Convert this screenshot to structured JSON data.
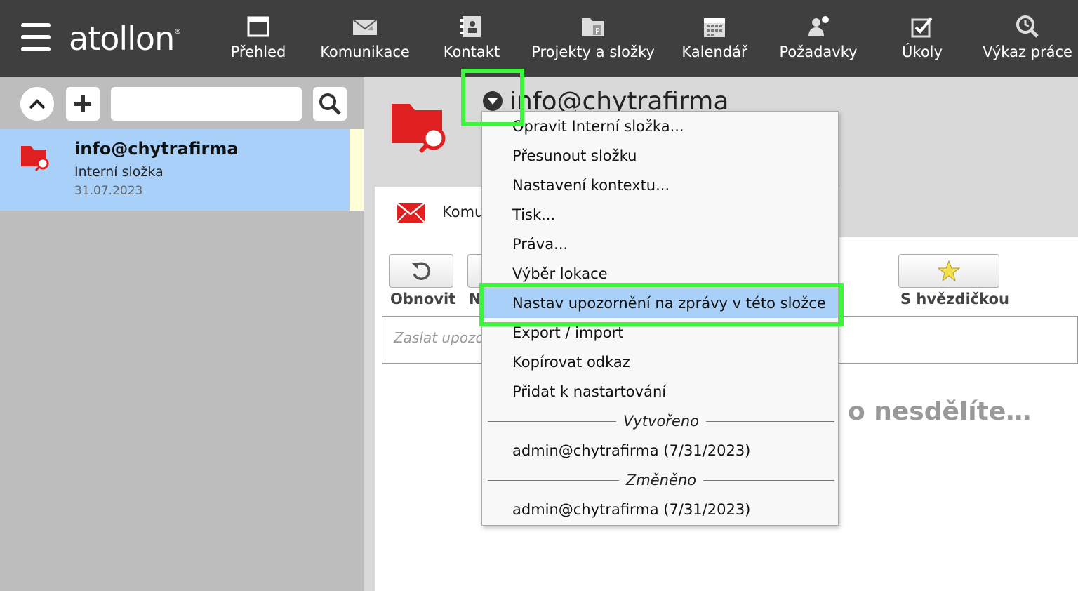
{
  "app": {
    "logo": "atollon",
    "logo_mark": "®"
  },
  "nav": [
    {
      "label": "Přehled",
      "icon": "overview-icon"
    },
    {
      "label": "Komunikace",
      "icon": "mail-icon"
    },
    {
      "label": "Kontakt",
      "icon": "contact-book-icon"
    },
    {
      "label": "Projekty a složky",
      "icon": "project-folder-icon"
    },
    {
      "label": "Kalendář",
      "icon": "calendar-icon"
    },
    {
      "label": "Požadavky",
      "icon": "request-icon"
    },
    {
      "label": "Úkoly",
      "icon": "task-check-icon"
    },
    {
      "label": "Výkaz práce",
      "icon": "time-report-icon"
    }
  ],
  "left_panel": {
    "search_value": "",
    "item": {
      "title": "info@chytrafirma",
      "subtitle": "Interní složka",
      "date": "31.07.2023"
    }
  },
  "main": {
    "title": "info@chytrafirma",
    "tab_label": "Komu",
    "toolbar": {
      "refresh_label": "Obnovit",
      "second_label": "N",
      "starred_label": "S hvězdičkou"
    },
    "message_placeholder": "Zaslat upozo",
    "empty_text": "o nesdělíte…"
  },
  "menu": {
    "items": [
      "Opravit Interní složka...",
      "Přesunout složku",
      "Nastavení kontextu...",
      "Tisk...",
      "Práva...",
      "Výběr lokace",
      "Nastav upozornění na zprávy v této složce",
      "Export / import",
      "Kopírovat odkaz",
      "Přidat k nastartování"
    ],
    "selected_index": 6,
    "created_header": "Vytvořeno",
    "created_by": "admin@chytrafirma  (7/31/2023)",
    "changed_header": "Změněno",
    "changed_by": "admin@chytrafirma  (7/31/2023)"
  },
  "colors": {
    "topbar": "#3f3f3f",
    "selection": "#a8d0f8",
    "folder_red": "#e02020",
    "highlight": "#3cf53c"
  }
}
